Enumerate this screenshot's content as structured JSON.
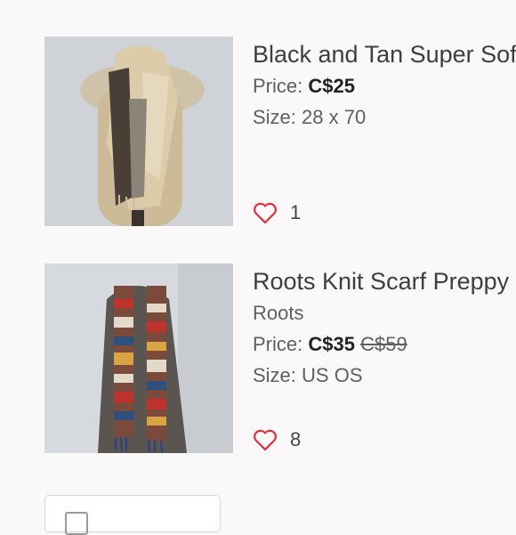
{
  "listings": [
    {
      "title": "Black and Tan Super Soft Scarf",
      "brand": "",
      "price_label": "Price:",
      "price": "C$25",
      "original_price": "",
      "size_label": "Size:",
      "size": "28 x 70",
      "likes": "1",
      "image": "Tan and black plaid scarf on a mannequin"
    },
    {
      "title": "Roots Knit Scarf Preppy",
      "brand": "Roots",
      "price_label": "Price:",
      "price": "C$35",
      "original_price": "C$59",
      "size_label": "Size:",
      "size": "US OS",
      "likes": "8",
      "image": "Multicolor fair isle knit scarf on a mannequin"
    }
  ],
  "colors": {
    "heart": "#e0303a",
    "background": "#fbf8f9",
    "title": "#3e3e3e"
  },
  "icons": {
    "like": "heart-outline-icon",
    "bottom": "checkbox-icon"
  }
}
